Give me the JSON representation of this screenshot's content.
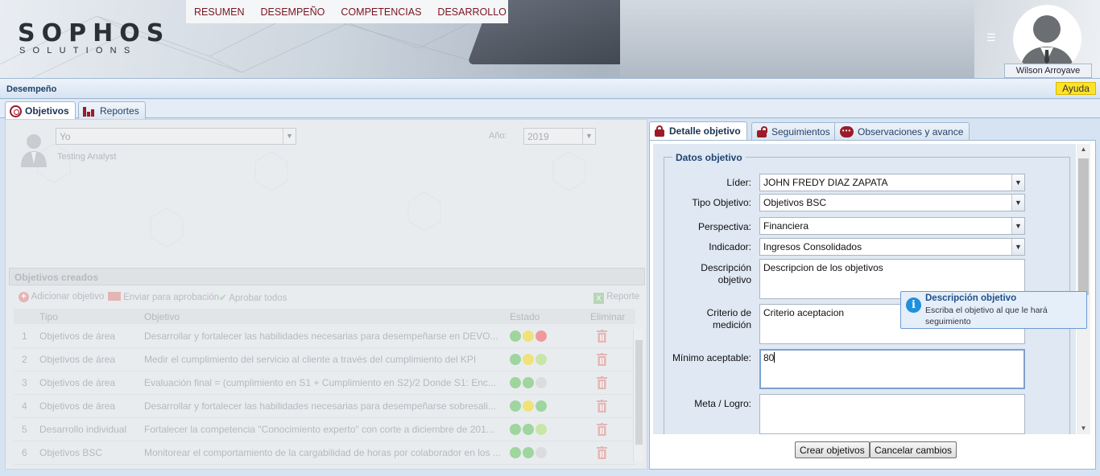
{
  "app": {
    "logo_main": "SOPHOS",
    "logo_sub": "SOLUTIONS",
    "nav": [
      "RESUMEN",
      "DESEMPEÑO",
      "COMPETENCIAS",
      "DESARROLLO"
    ],
    "user_name": "Wilson Arroyave",
    "menu_icon": "hamburger-icon"
  },
  "page": {
    "title": "Desempeño",
    "help_label": "Ayuda",
    "tabs": [
      {
        "label": "Objetivos",
        "icon": "target-icon",
        "active": true
      },
      {
        "label": "Reportes",
        "icon": "bar-chart-icon",
        "active": false
      }
    ]
  },
  "left": {
    "employee_select": "Yo",
    "employee_role": "Testing Analyst",
    "year_label": "Año:",
    "year_value": "2019",
    "objectives_title": "Objetivos creados",
    "toolbar": {
      "add": "Adicionar objetivo",
      "send": "Enviar para aprobación",
      "approve": "Aprobar todos",
      "report": "Reporte"
    },
    "columns": [
      "Tipo",
      "Objetivo",
      "Estado",
      "Eliminar"
    ],
    "rows": [
      {
        "n": "1",
        "tipo": "Objetivos de área",
        "objetivo": "Desarrollar y fortalecer las habilidades necesarias para desempeñarse en DEVO...",
        "estado": [
          "#9fd59f",
          "#f0e27a",
          "#ef9a9a"
        ]
      },
      {
        "n": "2",
        "tipo": "Objetivos de área",
        "objetivo": "Medir el cumplimiento del servicio al cliente a través del cumplimiento del KPI",
        "estado": [
          "#9fd59f",
          "#f0e27a",
          "#c8e6a8"
        ]
      },
      {
        "n": "3",
        "tipo": "Objetivos de área",
        "objetivo": "Evaluación final = (cumplimiento en S1 + Cumplimiento en S2)/2 Donde S1: Enc...",
        "estado": [
          "#9fd59f",
          "#9fd59f",
          "#dcdcdc"
        ]
      },
      {
        "n": "4",
        "tipo": "Objetivos de área",
        "objetivo": "Desarrollar y fortalecer las habilidades necesarias para desempeñarse sobresali...",
        "estado": [
          "#9fd59f",
          "#f0e27a",
          "#9fd59f"
        ]
      },
      {
        "n": "5",
        "tipo": "Desarrollo individual",
        "objetivo": "Fortalecer la competencia \"Conocimiento experto\" con corte a diciembre de 201...",
        "estado": [
          "#9fd59f",
          "#9fd59f",
          "#c8e6a8"
        ]
      },
      {
        "n": "6",
        "tipo": "Objetivos BSC",
        "objetivo": "Monitorear el comportamiento de la cargabilidad de horas por colaborador en los ...",
        "estado": [
          "#9fd59f",
          "#9fd59f",
          "#dcdcdc"
        ]
      }
    ]
  },
  "right": {
    "tabs": [
      "Detalle objetivo",
      "Seguimientos",
      "Observaciones y avance"
    ],
    "legend": "Datos objetivo",
    "fields": {
      "lider_label": "Líder:",
      "lider_value": "JOHN FREDY DIAZ ZAPATA",
      "tipo_label": "Tipo Objetivo:",
      "tipo_value": "Objetivos BSC",
      "perspectiva_label": "Perspectiva:",
      "perspectiva_value": "Financiera",
      "indicador_label": "Indicador:",
      "indicador_value": "Ingresos Consolidados",
      "descripcion_label_1": "Descripción",
      "descripcion_label_2": "objetivo",
      "descripcion_value": "Descripcion de los objetivos",
      "criterio_label_1": "Criterio de",
      "criterio_label_2": "medición",
      "criterio_value": "Criterio aceptacion",
      "minimo_label": "Mínimo aceptable:",
      "minimo_value": "80",
      "meta_label": "Meta / Logro:",
      "meta_value": ""
    },
    "tooltip": {
      "title": "Descripción objetivo",
      "body": "Escriba el objetivo al que le hará seguimiento"
    },
    "buttons": {
      "create": "Crear objetivos",
      "cancel": "Cancelar cambios"
    }
  }
}
